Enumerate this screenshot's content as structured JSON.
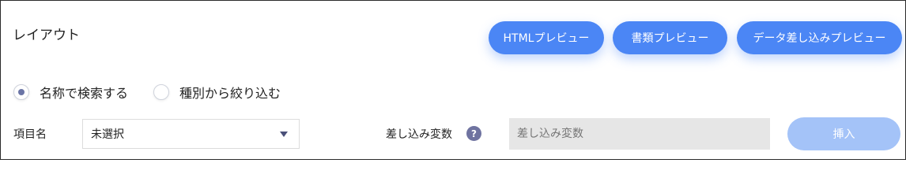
{
  "section": {
    "title": "レイアウト"
  },
  "preview_buttons": {
    "html": "HTMLプレビュー",
    "document": "書類プレビュー",
    "data_merge": "データ差し込みプレビュー"
  },
  "search_mode": {
    "selected": "name",
    "options": [
      {
        "key": "name",
        "label": "名称で検索する"
      },
      {
        "key": "type",
        "label": "種別から絞り込む"
      }
    ]
  },
  "item": {
    "label": "項目名",
    "selected_value": "未選択"
  },
  "merge_variable": {
    "label": "差し込み変数",
    "help_icon_text": "?",
    "placeholder": "差し込み変数",
    "disabled": true
  },
  "insert_button": {
    "label": "挿入",
    "disabled": true
  },
  "colors": {
    "primary": "#4b86f5",
    "primary_disabled": "#a4c3f8",
    "radio_dot": "#6b75a6"
  }
}
